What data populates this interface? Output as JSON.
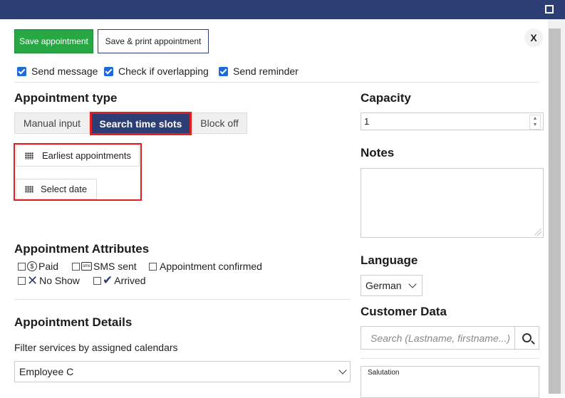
{
  "toolbar": {
    "save_label": "Save appointment",
    "save_print_label": "Save & print appointment",
    "close_label": "X"
  },
  "options": {
    "send_message": "Send message",
    "check_overlapping": "Check if overlapping",
    "send_reminder": "Send reminder"
  },
  "appointment_type": {
    "heading": "Appointment type",
    "tabs": [
      "Manual input",
      "Search time slots",
      "Block off"
    ],
    "active_tab": "Search time slots",
    "earliest": "Earliest appointments",
    "select_date": "Select date"
  },
  "attributes": {
    "heading": "Appointment Attributes",
    "paid": "Paid",
    "sms_sent": "SMS sent",
    "confirmed": "Appointment confirmed",
    "no_show": "No Show",
    "arrived": "Arrived"
  },
  "details": {
    "heading": "Appointment Details",
    "filter_label": "Filter services by assigned calendars",
    "selected_calendar": "Employee C"
  },
  "capacity": {
    "heading": "Capacity",
    "value": "1"
  },
  "notes": {
    "heading": "Notes"
  },
  "language": {
    "heading": "Language",
    "value": "German"
  },
  "customer": {
    "heading": "Customer Data",
    "search_placeholder": "Search (Lastname, firstname...)",
    "salutation_label": "Salutation"
  },
  "colors": {
    "titlebar": "#2c3e73",
    "save": "#28a745",
    "highlight": "#e02020",
    "checkbox": "#1e6ad8"
  }
}
